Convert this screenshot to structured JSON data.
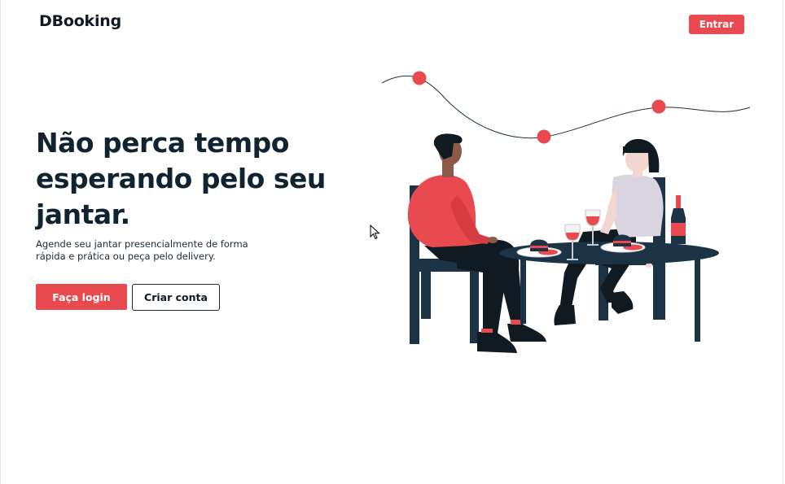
{
  "header": {
    "brand": "DBooking",
    "entrar_label": "Entrar"
  },
  "hero": {
    "title": "Não perca tempo esperando pelo seu jantar.",
    "subtitle": "Agende seu jantar presencialmente de forma rápida e prática ou peça pelo delivery.",
    "login_label": "Faça login",
    "signup_label": "Criar conta"
  },
  "colors": {
    "accent": "#e84a4f",
    "dark": "#0f2430",
    "navy": "#1b3344"
  },
  "icons": {
    "cursor": "mouse-pointer-icon"
  }
}
